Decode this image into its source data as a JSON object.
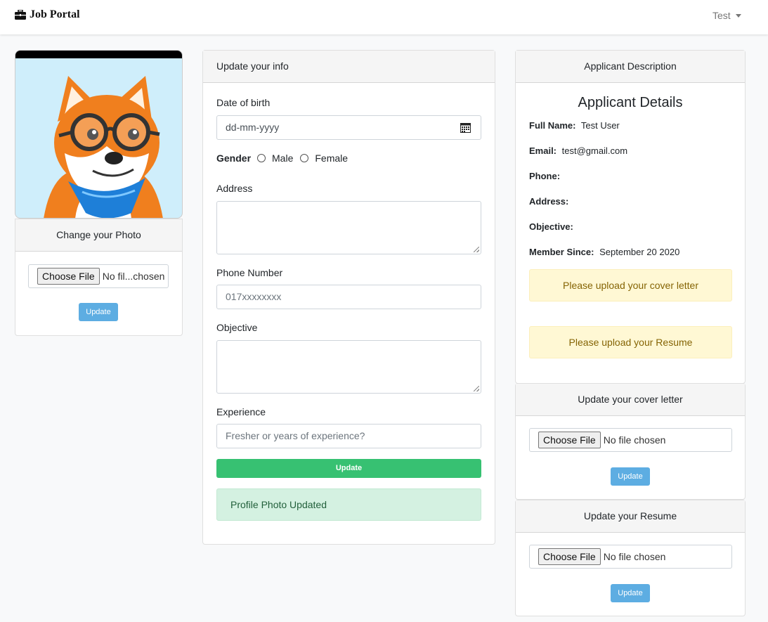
{
  "navbar": {
    "brand": "Job Portal",
    "brand_icon": "briefcase-icon",
    "user": "Test"
  },
  "photo_card": {
    "header": "Change your Photo",
    "choose_button": "Choose File",
    "file_status": "No fil...chosen",
    "update_button": "Update"
  },
  "info_card": {
    "header": "Update your info",
    "dob_label": "Date of birth",
    "dob_placeholder": "dd-mm-yyyy",
    "gender_label": "Gender",
    "gender_male": "Male",
    "gender_female": "Female",
    "address_label": "Address",
    "phone_label": "Phone Number",
    "phone_placeholder": "017xxxxxxxx",
    "objective_label": "Objective",
    "experience_label": "Experience",
    "experience_placeholder": "Fresher or years of experience?",
    "update_button": "Update",
    "success_message": "Profile Photo Updated"
  },
  "description_card": {
    "header": "Applicant Description",
    "title": "Applicant Details",
    "full_name_label": "Full Name:",
    "full_name": "Test User",
    "email_label": "Email:",
    "email": "test@gmail.com",
    "phone_label": "Phone:",
    "address_label": "Address:",
    "objective_label": "Objective:",
    "member_since_label": "Member Since:",
    "member_since": "September 20 2020",
    "cover_warning": "Please upload your cover letter",
    "resume_warning": "Please upload your Resume"
  },
  "cover_card": {
    "header": "Update your cover letter",
    "choose_button": "Choose File",
    "file_status": "No file chosen",
    "update_button": "Update"
  },
  "resume_card": {
    "header": "Update your Resume",
    "choose_button": "Choose File",
    "file_status": "No file chosen",
    "update_button": "Update"
  },
  "colors": {
    "success_button": "#37c172",
    "small_button": "#5dade2",
    "warning_bg": "#fff8d4",
    "success_bg": "#d4f1e1"
  }
}
